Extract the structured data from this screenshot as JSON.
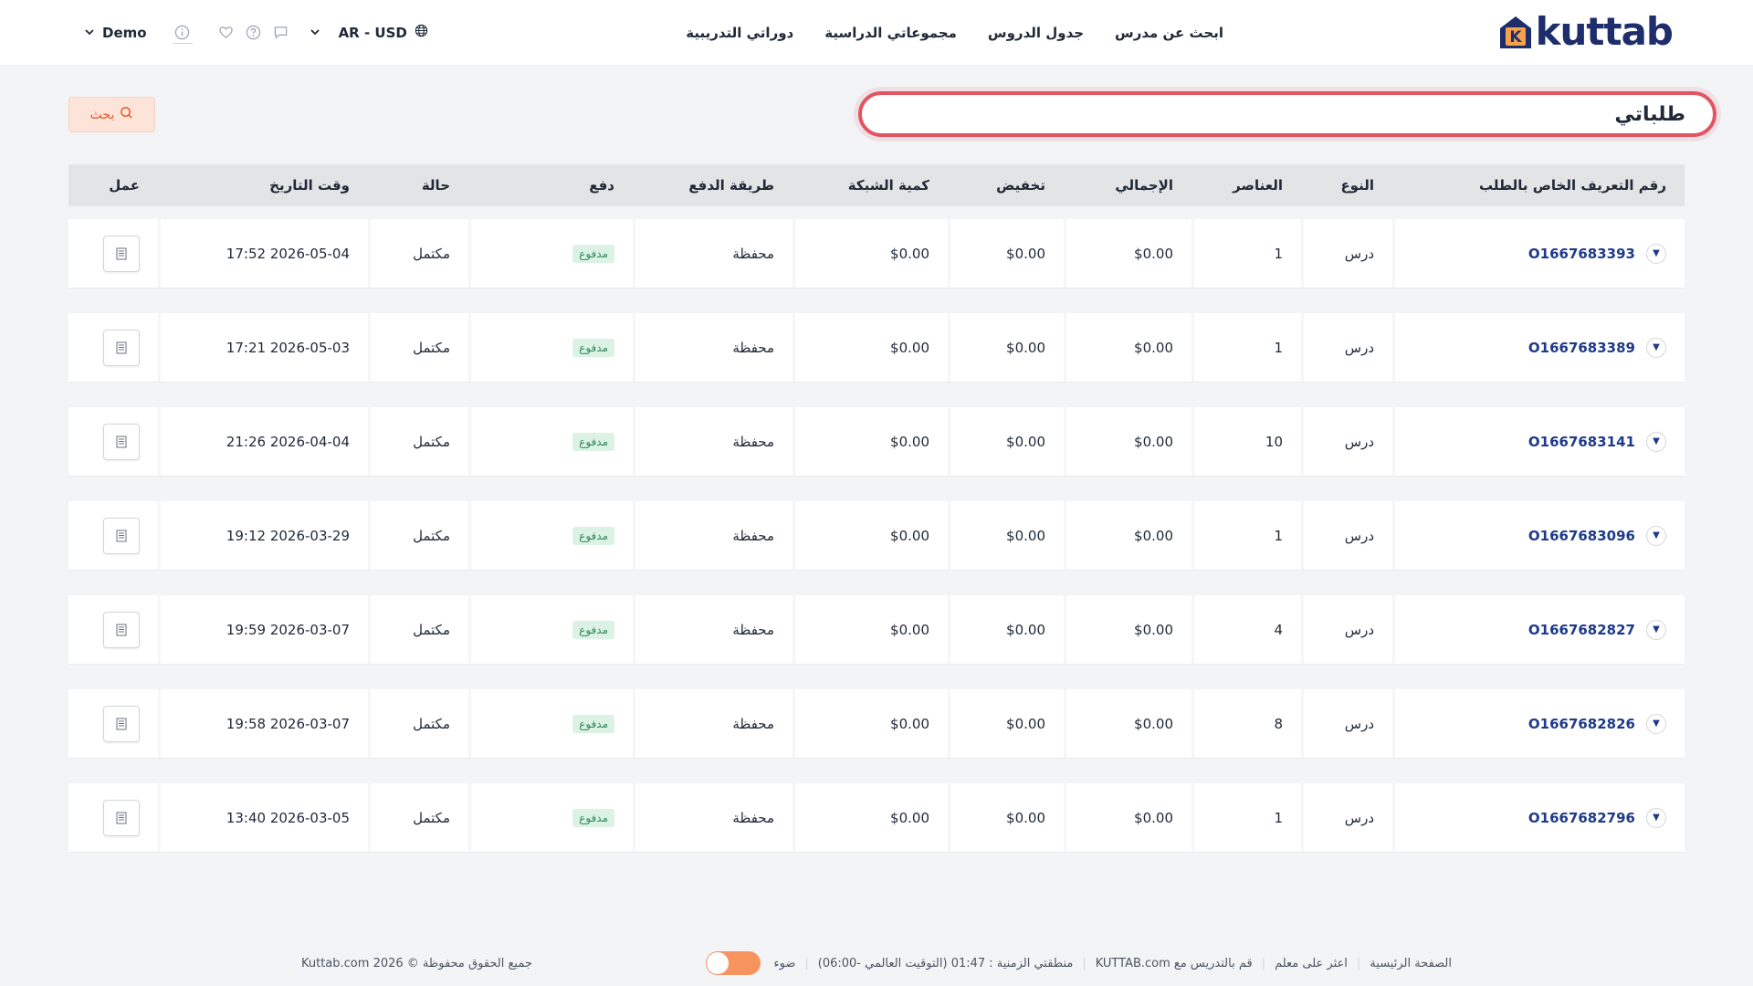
{
  "header": {
    "logo_text": "kuttab",
    "logo_letter": "K",
    "nav": [
      {
        "label": "ابحث عن مدرس"
      },
      {
        "label": "جدول الدروس"
      },
      {
        "label": "مجموعاتي الدراسية"
      },
      {
        "label": "دوراتي التدريبية"
      }
    ],
    "lang_currency": "AR - USD",
    "user_name": "Demo",
    "icons": [
      "chat-icon",
      "help-icon",
      "heart-icon",
      "info-icon"
    ]
  },
  "search": {
    "value": "طلباتي",
    "button_label": "بحث"
  },
  "table": {
    "headers": {
      "id": "رقم التعريف الخاص بالطلب",
      "type": "النوع",
      "items": "العناصر",
      "total": "الإجمالي",
      "discount": "تخفيض",
      "net": "كمية الشبكة",
      "method": "طريقة الدفع",
      "payment": "دفع",
      "status": "حالة",
      "datetime": "وقت التاريخ",
      "action": "عمل"
    },
    "rows": [
      {
        "id": "O1667683393",
        "type": "درس",
        "items": "1",
        "total": "$0.00",
        "discount": "$0.00",
        "net": "$0.00",
        "method": "محفظة",
        "payment": "مدفوع",
        "status": "مكتمل",
        "datetime": "2026-05-04 17:52"
      },
      {
        "id": "O1667683389",
        "type": "درس",
        "items": "1",
        "total": "$0.00",
        "discount": "$0.00",
        "net": "$0.00",
        "method": "محفظة",
        "payment": "مدفوع",
        "status": "مكتمل",
        "datetime": "2026-05-03 17:21"
      },
      {
        "id": "O1667683141",
        "type": "درس",
        "items": "10",
        "total": "$0.00",
        "discount": "$0.00",
        "net": "$0.00",
        "method": "محفظة",
        "payment": "مدفوع",
        "status": "مكتمل",
        "datetime": "2026-04-04 21:26"
      },
      {
        "id": "O1667683096",
        "type": "درس",
        "items": "1",
        "total": "$0.00",
        "discount": "$0.00",
        "net": "$0.00",
        "method": "محفظة",
        "payment": "مدفوع",
        "status": "مكتمل",
        "datetime": "2026-03-29 19:12"
      },
      {
        "id": "O1667682827",
        "type": "درس",
        "items": "4",
        "total": "$0.00",
        "discount": "$0.00",
        "net": "$0.00",
        "method": "محفظة",
        "payment": "مدفوع",
        "status": "مكتمل",
        "datetime": "2026-03-07 19:59"
      },
      {
        "id": "O1667682826",
        "type": "درس",
        "items": "8",
        "total": "$0.00",
        "discount": "$0.00",
        "net": "$0.00",
        "method": "محفظة",
        "payment": "مدفوع",
        "status": "مكتمل",
        "datetime": "2026-03-07 19:58"
      },
      {
        "id": "O1667682796",
        "type": "درس",
        "items": "1",
        "total": "$0.00",
        "discount": "$0.00",
        "net": "$0.00",
        "method": "محفظة",
        "payment": "مدفوع",
        "status": "مكتمل",
        "datetime": "2026-03-05 13:40"
      }
    ]
  },
  "footer": {
    "links": [
      "الصفحة الرئيسية",
      "اعثر على معلم",
      "قم بالتدريس مع KUTTAB.com",
      "منطقتي الزمنية : 01:47 (التوقيت العالمي -06:00)",
      "ضوء"
    ],
    "copyright": "جميع الحقوق محفوظة © 2026 Kuttab.com"
  },
  "colors": {
    "accent": "#e05561",
    "brand": "#1e2d6b",
    "link": "#1e3a8a",
    "paid_bg": "#dcf2e5",
    "paid_text": "#2f8a57",
    "toggle": "#f7935f"
  }
}
